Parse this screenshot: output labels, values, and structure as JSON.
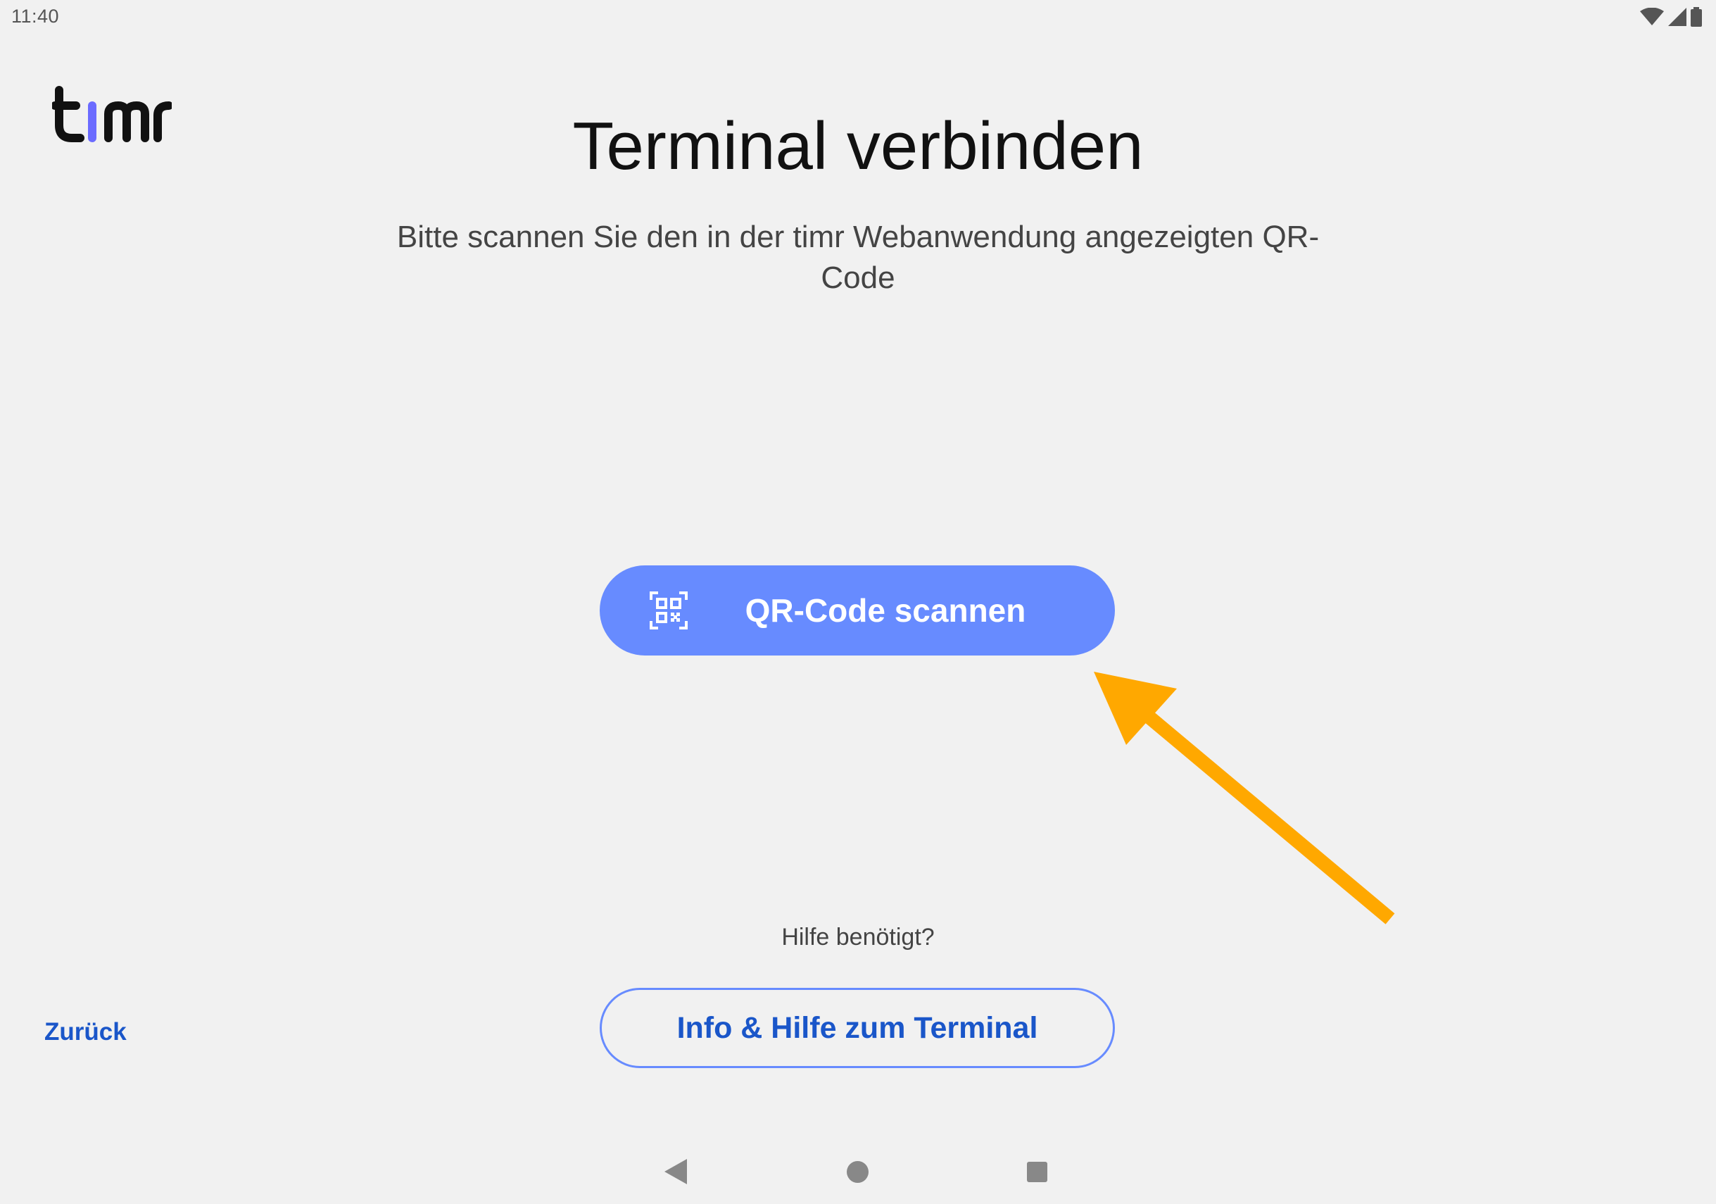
{
  "status_bar": {
    "time": "11:40",
    "icons": [
      "wifi-icon",
      "cell-signal-icon",
      "battery-icon"
    ]
  },
  "logo": {
    "text": "timr",
    "accent_color": "#6b6bff"
  },
  "header": {
    "title": "Terminal verbinden",
    "subtitle": "Bitte scannen Sie den in der timr Webanwendung angezeigten QR-Code"
  },
  "scan_button": {
    "icon": "qr-code-icon",
    "label": "QR-Code scannen",
    "color": "#678bff"
  },
  "annotation": {
    "icon": "arrow-icon",
    "color": "#ffa800"
  },
  "help": {
    "prompt": "Hilfe benötigt?",
    "button_label": "Info & Hilfe zum Terminal"
  },
  "navigation": {
    "back_label": "Zurück"
  },
  "system_nav": {
    "icons": [
      "back-triangle-icon",
      "home-circle-icon",
      "recents-square-icon"
    ]
  }
}
